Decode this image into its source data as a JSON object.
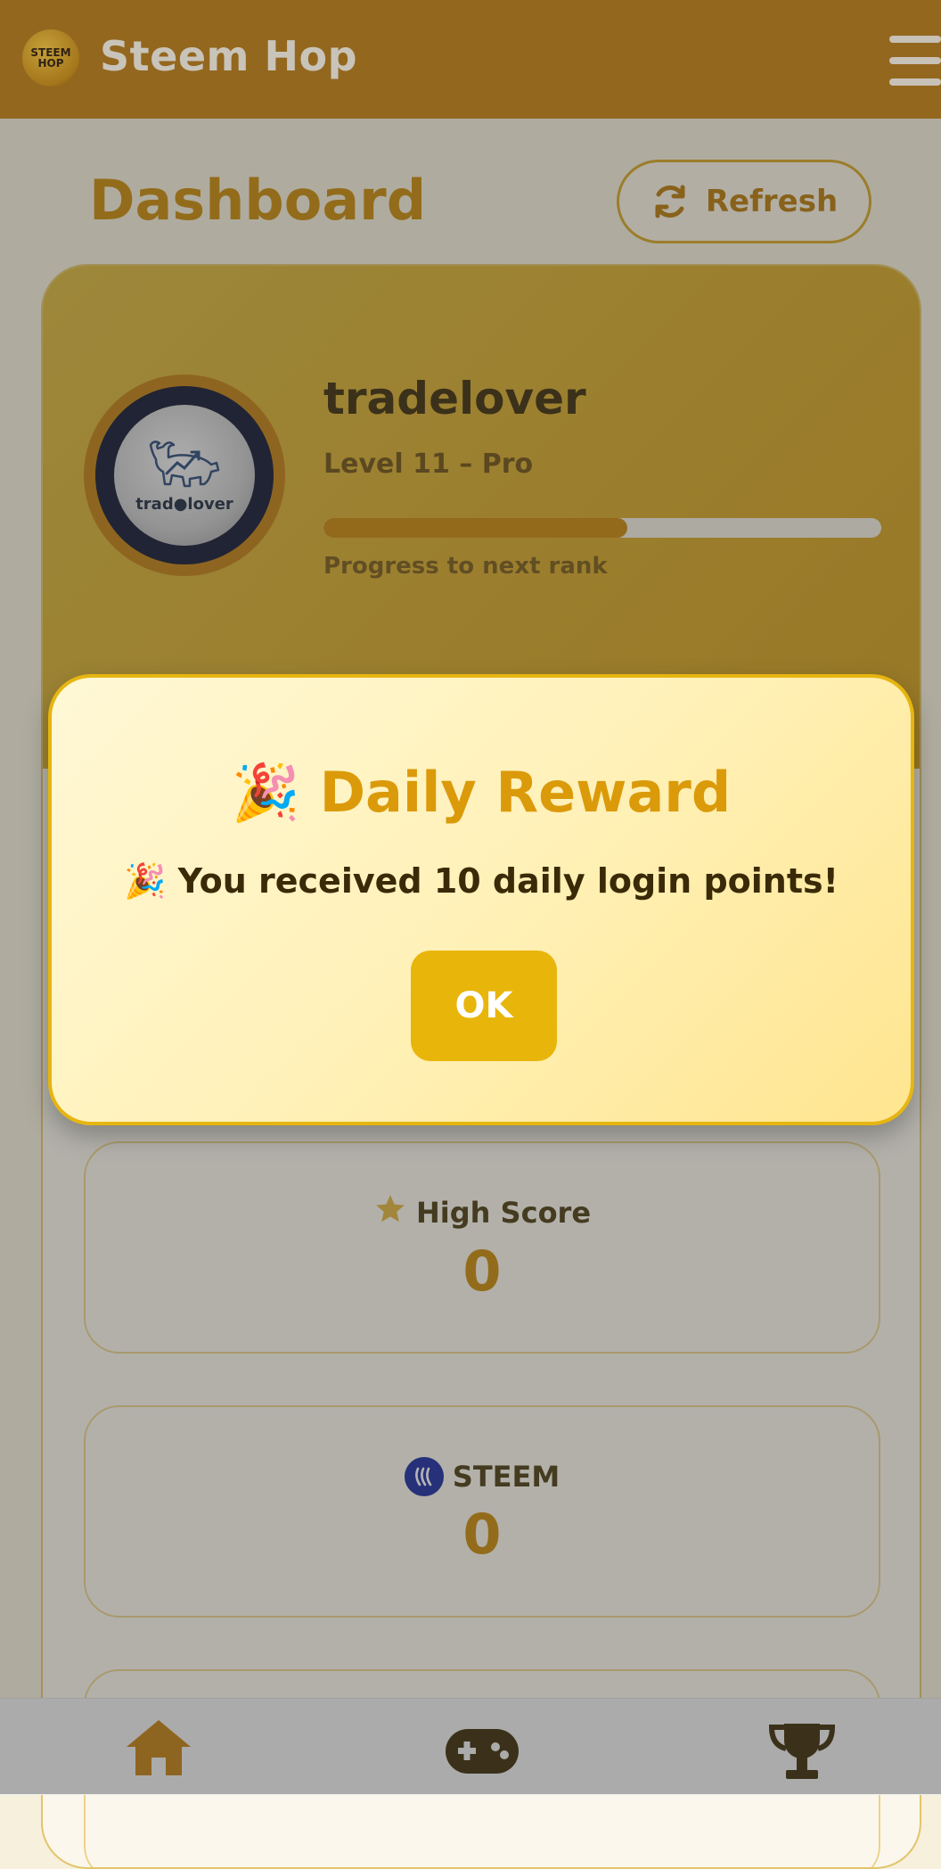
{
  "header": {
    "app_title": "Steem Hop",
    "logo_text_1": "STEEM",
    "logo_text_2": "HOP"
  },
  "page": {
    "title": "Dashboard",
    "refresh_label": "Refresh"
  },
  "profile": {
    "username": "tradelover",
    "level": "Level 11 – Pro",
    "progress_label": "Progress to next rank",
    "progress_fraction": 0.545,
    "avatar_text": "trad●lover"
  },
  "stats": [
    {
      "label": "High Score",
      "value": "0",
      "icon": "star-icon"
    },
    {
      "label": "STEEM",
      "value": "0",
      "icon": "steem-icon"
    }
  ],
  "modal": {
    "emoji": "🎉",
    "title": "Daily Reward",
    "message_emoji": "🎉",
    "message": "You received 10 daily login points!",
    "ok_label": "OK"
  },
  "nav": {
    "items": [
      "home-icon",
      "gamepad-icon",
      "trophy-icon"
    ]
  },
  "colors": {
    "brand": "#b07614",
    "accent": "#c98a08",
    "modal_button": "#e8b50a"
  }
}
